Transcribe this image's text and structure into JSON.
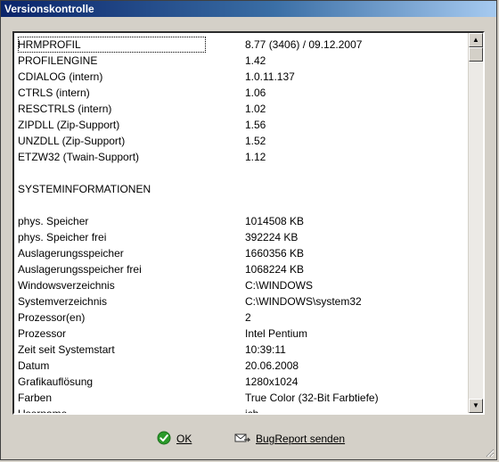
{
  "window": {
    "title": "Versionskontrolle"
  },
  "list": {
    "rows": [
      {
        "key": "HRMPROFIL",
        "value": "8.77 (3406) / 09.12.2007"
      },
      {
        "key": "PROFILENGINE",
        "value": "1.42"
      },
      {
        "key": "CDIALOG (intern)",
        "value": "1.0.11.137"
      },
      {
        "key": "CTRLS (intern)",
        "value": "1.06"
      },
      {
        "key": "RESCTRLS (intern)",
        "value": "1.02"
      },
      {
        "key": "ZIPDLL (Zip-Support)",
        "value": "1.56"
      },
      {
        "key": "UNZDLL (Zip-Support)",
        "value": "1.52"
      },
      {
        "key": "ETZW32 (Twain-Support)",
        "value": "1.12"
      },
      {
        "key": "",
        "value": ""
      },
      {
        "key": "SYSTEMINFORMATIONEN",
        "value": ""
      },
      {
        "key": "",
        "value": ""
      },
      {
        "key": "phys. Speicher",
        "value": "1014508 KB"
      },
      {
        "key": "phys. Speicher frei",
        "value": "392224 KB"
      },
      {
        "key": "Auslagerungsspeicher",
        "value": "1660356 KB"
      },
      {
        "key": "Auslagerungsspeicher frei",
        "value": "1068224 KB"
      },
      {
        "key": "Windowsverzeichnis",
        "value": "C:\\WINDOWS"
      },
      {
        "key": "Systemverzeichnis",
        "value": "C:\\WINDOWS\\system32"
      },
      {
        "key": "Prozessor(en)",
        "value": "2"
      },
      {
        "key": "Prozessor",
        "value": "Intel Pentium"
      },
      {
        "key": "Zeit seit Systemstart",
        "value": "10:39:11"
      },
      {
        "key": "Datum",
        "value": "20.06.2008"
      },
      {
        "key": "Grafikauflösung",
        "value": "1280x1024"
      },
      {
        "key": "Farben",
        "value": "True Color (32-Bit Farbtiefe)"
      },
      {
        "key": "Username",
        "value": "ich"
      }
    ]
  },
  "buttons": {
    "ok_label": "OK",
    "bugreport_label": "BugReport senden"
  },
  "icons": {
    "ok": "check-circle-icon",
    "bugreport": "bug-send-icon",
    "scroll_up": "arrow-up-icon",
    "scroll_down": "arrow-down-icon"
  },
  "colors": {
    "titlebar_start": "#0a246a",
    "titlebar_end": "#a6caf0",
    "ok_green": "#2a9a2a"
  }
}
